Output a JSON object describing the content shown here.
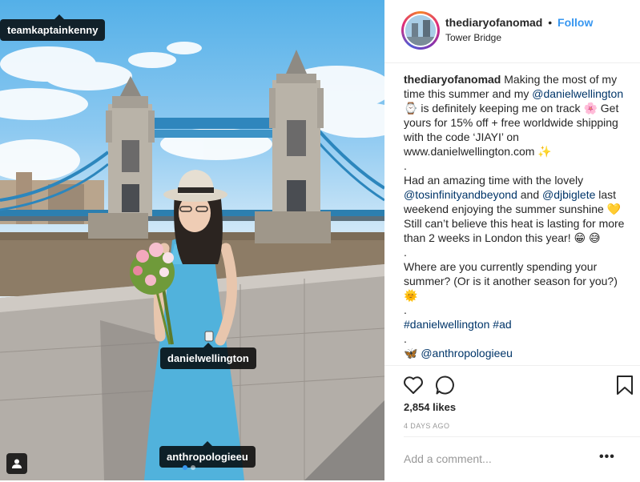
{
  "photo": {
    "tags": [
      "teamkaptainkenny",
      "danielwellington",
      "anthropologieeu"
    ],
    "user_tag_icon": "user-icon",
    "carousel_dots": 2,
    "active_dot": 1
  },
  "header": {
    "username": "thediaryofanomad",
    "separator": "•",
    "follow_label": "Follow",
    "location": "Tower Bridge"
  },
  "caption": {
    "username": "thediaryofanomad",
    "p1_a": "Making the most of my time this summer and my",
    "mention_1": "@danielwellington",
    "emoji_watch": "⌚",
    "p1_b": "is definitely keeping me on track",
    "emoji_flower": "🌸",
    "p1_c": "Get yours for 15% off + free worldwide shipping with the code ‘JIAYI’ on www.danielwellington.com",
    "emoji_sparkles": "✨",
    "dot_1": ".",
    "p2_a": "Had an amazing time with the lovely",
    "mention_2": "@tosinfinityandbeyond",
    "p2_and": "and",
    "mention_3": "@djbiglete",
    "p2_b": "last weekend enjoying the summer sunshine",
    "emoji_heart": "💛",
    "p2_c": "Still can’t believe this heat is lasting for more than 2 weeks in London this year!",
    "emoji_grin": "😁",
    "emoji_sweat": "😅",
    "dot_2": ".",
    "p3": "Where are you currently spending your summer? (Or is it another season for you?)",
    "emoji_sun": "🌞",
    "dot_3": ".",
    "hashtags": "#danielwellington #ad",
    "dot_4": ".",
    "cutoff": "🦋 @anthropologieeu"
  },
  "actions": {
    "like_icon": "heart-icon",
    "comment_icon": "comment-icon",
    "save_icon": "bookmark-icon",
    "likes": "2,854 likes",
    "time": "4 DAYS AGO"
  },
  "comment": {
    "placeholder": "Add a comment...",
    "more_label": "•••"
  },
  "colors": {
    "link": "#3897f0",
    "mention": "#003569",
    "text": "#262626",
    "muted": "#999999",
    "border": "#efefef"
  }
}
